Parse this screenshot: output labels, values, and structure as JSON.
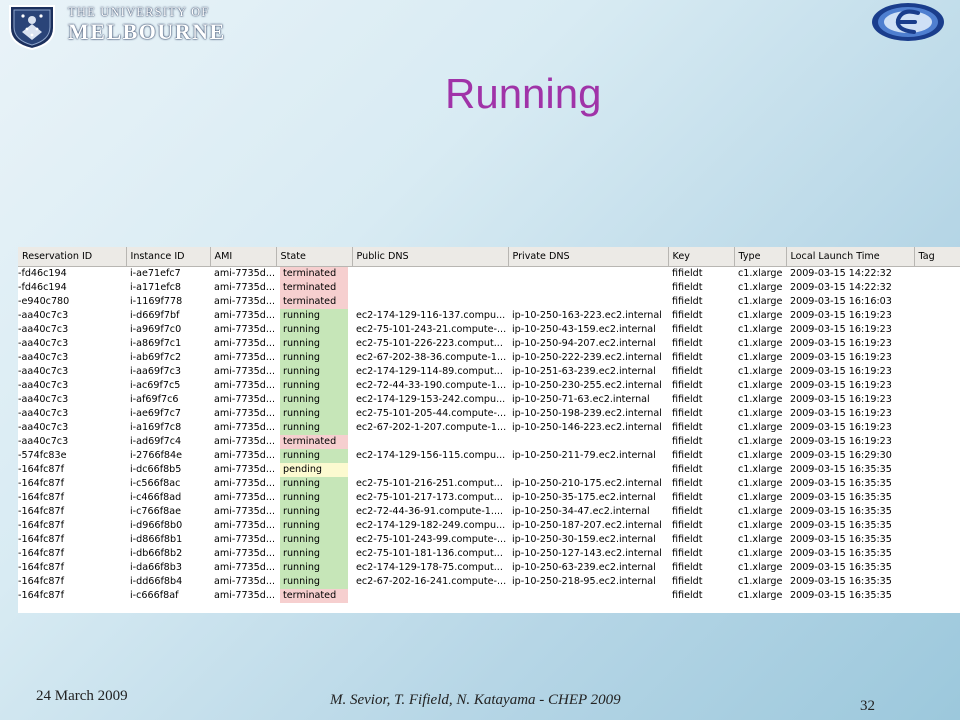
{
  "header": {
    "university_line1": "THE UNIVERSITY OF",
    "university_line2": "MELBOURNE",
    "crest_icon": "university-crest-icon",
    "right_logo_icon": "egee-logo-icon"
  },
  "slide": {
    "title": "Running",
    "title_color": "#a033a8"
  },
  "table": {
    "columns": [
      "Reservation ID",
      "Instance ID",
      "AMI",
      "State",
      "Public DNS",
      "Private DNS",
      "Key",
      "Type",
      "Local Launch Time",
      "Tag"
    ],
    "state_colors": {
      "running": "#c6e6b8",
      "terminated": "#f6cfcf",
      "pending": "#fcfad0"
    },
    "rows": [
      [
        "-fd46c194",
        "i-ae71efc7",
        "ami-7735d...",
        "terminated",
        "",
        "",
        "fifieldt",
        "c1.xlarge",
        "2009-03-15 14:22:32",
        ""
      ],
      [
        "-fd46c194",
        "i-a171efc8",
        "ami-7735d...",
        "terminated",
        "",
        "",
        "fifieldt",
        "c1.xlarge",
        "2009-03-15 14:22:32",
        ""
      ],
      [
        "-e940c780",
        "i-1169f778",
        "ami-7735d...",
        "terminated",
        "",
        "",
        "fifieldt",
        "c1.xlarge",
        "2009-03-15 16:16:03",
        ""
      ],
      [
        "-aa40c7c3",
        "i-d669f7bf",
        "ami-7735d...",
        "running",
        "ec2-174-129-116-137.compu...",
        "ip-10-250-163-223.ec2.internal",
        "fifieldt",
        "c1.xlarge",
        "2009-03-15 16:19:23",
        ""
      ],
      [
        "-aa40c7c3",
        "i-a969f7c0",
        "ami-7735d...",
        "running",
        "ec2-75-101-243-21.compute-...",
        "ip-10-250-43-159.ec2.internal",
        "fifieldt",
        "c1.xlarge",
        "2009-03-15 16:19:23",
        ""
      ],
      [
        "-aa40c7c3",
        "i-a869f7c1",
        "ami-7735d...",
        "running",
        "ec2-75-101-226-223.comput...",
        "ip-10-250-94-207.ec2.internal",
        "fifieldt",
        "c1.xlarge",
        "2009-03-15 16:19:23",
        ""
      ],
      [
        "-aa40c7c3",
        "i-ab69f7c2",
        "ami-7735d...",
        "running",
        "ec2-67-202-38-36.compute-1...",
        "ip-10-250-222-239.ec2.internal",
        "fifieldt",
        "c1.xlarge",
        "2009-03-15 16:19:23",
        ""
      ],
      [
        "-aa40c7c3",
        "i-aa69f7c3",
        "ami-7735d...",
        "running",
        "ec2-174-129-114-89.comput...",
        "ip-10-251-63-239.ec2.internal",
        "fifieldt",
        "c1.xlarge",
        "2009-03-15 16:19:23",
        ""
      ],
      [
        "-aa40c7c3",
        "i-ac69f7c5",
        "ami-7735d...",
        "running",
        "ec2-72-44-33-190.compute-1...",
        "ip-10-250-230-255.ec2.internal",
        "fifieldt",
        "c1.xlarge",
        "2009-03-15 16:19:23",
        ""
      ],
      [
        "-aa40c7c3",
        "i-af69f7c6",
        "ami-7735d...",
        "running",
        "ec2-174-129-153-242.compu...",
        "ip-10-250-71-63.ec2.internal",
        "fifieldt",
        "c1.xlarge",
        "2009-03-15 16:19:23",
        ""
      ],
      [
        "-aa40c7c3",
        "i-ae69f7c7",
        "ami-7735d...",
        "running",
        "ec2-75-101-205-44.compute-...",
        "ip-10-250-198-239.ec2.internal",
        "fifieldt",
        "c1.xlarge",
        "2009-03-15 16:19:23",
        ""
      ],
      [
        "-aa40c7c3",
        "i-a169f7c8",
        "ami-7735d...",
        "running",
        "ec2-67-202-1-207.compute-1...",
        "ip-10-250-146-223.ec2.internal",
        "fifieldt",
        "c1.xlarge",
        "2009-03-15 16:19:23",
        ""
      ],
      [
        "-aa40c7c3",
        "i-ad69f7c4",
        "ami-7735d...",
        "terminated",
        "",
        "",
        "fifieldt",
        "c1.xlarge",
        "2009-03-15 16:19:23",
        ""
      ],
      [
        "-574fc83e",
        "i-2766f84e",
        "ami-7735d...",
        "running",
        "ec2-174-129-156-115.compu...",
        "ip-10-250-211-79.ec2.internal",
        "fifieldt",
        "c1.xlarge",
        "2009-03-15 16:29:30",
        ""
      ],
      [
        "-164fc87f",
        "i-dc66f8b5",
        "ami-7735d...",
        "pending",
        "",
        "",
        "fifieldt",
        "c1.xlarge",
        "2009-03-15 16:35:35",
        ""
      ],
      [
        "-164fc87f",
        "i-c566f8ac",
        "ami-7735d...",
        "running",
        "ec2-75-101-216-251.comput...",
        "ip-10-250-210-175.ec2.internal",
        "fifieldt",
        "c1.xlarge",
        "2009-03-15 16:35:35",
        ""
      ],
      [
        "-164fc87f",
        "i-c466f8ad",
        "ami-7735d...",
        "running",
        "ec2-75-101-217-173.comput...",
        "ip-10-250-35-175.ec2.internal",
        "fifieldt",
        "c1.xlarge",
        "2009-03-15 16:35:35",
        ""
      ],
      [
        "-164fc87f",
        "i-c766f8ae",
        "ami-7735d...",
        "running",
        "ec2-72-44-36-91.compute-1....",
        "ip-10-250-34-47.ec2.internal",
        "fifieldt",
        "c1.xlarge",
        "2009-03-15 16:35:35",
        ""
      ],
      [
        "-164fc87f",
        "i-d966f8b0",
        "ami-7735d...",
        "running",
        "ec2-174-129-182-249.compu...",
        "ip-10-250-187-207.ec2.internal",
        "fifieldt",
        "c1.xlarge",
        "2009-03-15 16:35:35",
        ""
      ],
      [
        "-164fc87f",
        "i-d866f8b1",
        "ami-7735d...",
        "running",
        "ec2-75-101-243-99.compute-...",
        "ip-10-250-30-159.ec2.internal",
        "fifieldt",
        "c1.xlarge",
        "2009-03-15 16:35:35",
        ""
      ],
      [
        "-164fc87f",
        "i-db66f8b2",
        "ami-7735d...",
        "running",
        "ec2-75-101-181-136.comput...",
        "ip-10-250-127-143.ec2.internal",
        "fifieldt",
        "c1.xlarge",
        "2009-03-15 16:35:35",
        ""
      ],
      [
        "-164fc87f",
        "i-da66f8b3",
        "ami-7735d...",
        "running",
        "ec2-174-129-178-75.comput...",
        "ip-10-250-63-239.ec2.internal",
        "fifieldt",
        "c1.xlarge",
        "2009-03-15 16:35:35",
        ""
      ],
      [
        "-164fc87f",
        "i-dd66f8b4",
        "ami-7735d...",
        "running",
        "ec2-67-202-16-241.compute-...",
        "ip-10-250-218-95.ec2.internal",
        "fifieldt",
        "c1.xlarge",
        "2009-03-15 16:35:35",
        ""
      ],
      [
        "-164fc87f",
        "i-c666f8af",
        "ami-7735d...",
        "terminated",
        "",
        "",
        "fifieldt",
        "c1.xlarge",
        "2009-03-15 16:35:35",
        ""
      ]
    ]
  },
  "footer": {
    "date": "24 March 2009",
    "citation": "M. Sevior, T. Fifield, N. Katayama - CHEP 2009",
    "page_number": "32"
  }
}
